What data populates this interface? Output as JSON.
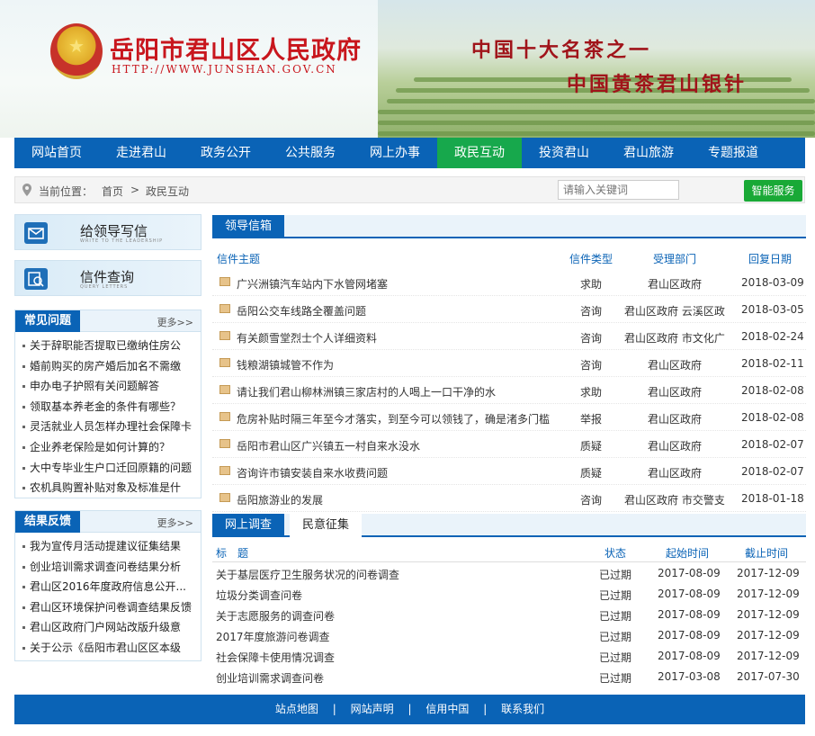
{
  "header": {
    "site_title": "岳阳市君山区人民政府",
    "site_url": "HTTP://WWW.JUNSHAN.GOV.CN",
    "slogan_line1": "中国十大名茶之一",
    "slogan_line2": "中国黄茶君山银针"
  },
  "nav": [
    "网站首页",
    "走进君山",
    "政务公开",
    "公共服务",
    "网上办事",
    "政民互动",
    "投资君山",
    "君山旅游",
    "专题报道"
  ],
  "nav_active_index": 5,
  "breadcrumb": {
    "label": "当前位置：",
    "home": "首页",
    "sep": ">",
    "current": "政民互动"
  },
  "search": {
    "placeholder": "请输入关键词",
    "button": "智能服务"
  },
  "side_buttons": [
    {
      "title": "给领导写信",
      "sub": "WRITE TO THE LEADERSHIP"
    },
    {
      "title": "信件查询",
      "sub": "QUERY LETTERS"
    }
  ],
  "faq": {
    "title": "常见问题",
    "more": "更多>>",
    "items": [
      "关于辞职能否提取已缴纳住房公",
      "婚前购买的房产婚后加名不需缴",
      "申办电子护照有关问题解答",
      "领取基本养老金的条件有哪些？",
      "灵活就业人员怎样办理社会保障卡",
      "企业养老保险是如何计算的？",
      "大中专毕业生户口迁回原籍的问题",
      "农机具购置补贴对象及标准是什"
    ]
  },
  "feedback": {
    "title": "结果反馈",
    "more": "更多>>",
    "items": [
      "我为宣传月活动提建议征集结果",
      "创业培训需求调查问卷结果分析",
      "君山区2016年度政府信息公开...",
      "君山区环境保护问卷调查结果反馈",
      "君山区政府门户网站改版升级意",
      "关于公示《岳阳市君山区区本级"
    ]
  },
  "mailbox": {
    "tab": "领导信箱",
    "columns": [
      "信件主题",
      "信件类型",
      "受理部门",
      "回复日期"
    ],
    "rows": [
      [
        "广兴洲镇汽车站内下水管网堵塞",
        "求助",
        "君山区政府",
        "2018-03-09"
      ],
      [
        "岳阳公交车线路全覆盖问题",
        "咨询",
        "君山区政府 云溪区政",
        "2018-03-05"
      ],
      [
        "有关颜雪堂烈士个人详细资料",
        "咨询",
        "君山区政府 市文化广",
        "2018-02-24"
      ],
      [
        "钱粮湖镇城管不作为",
        "咨询",
        "君山区政府",
        "2018-02-11"
      ],
      [
        "请让我们君山柳林洲镇三家店村的人喝上一口干净的水",
        "求助",
        "君山区政府",
        "2018-02-08"
      ],
      [
        "危房补贴时隔三年至今才落实，到至今可以领钱了，确是渚多门槛",
        "举报",
        "君山区政府",
        "2018-02-08"
      ],
      [
        "岳阳市君山区广兴镇五一村自来水没水",
        "质疑",
        "君山区政府",
        "2018-02-07"
      ],
      [
        "咨询许市镇安装自来水收费问题",
        "质疑",
        "君山区政府",
        "2018-02-07"
      ],
      [
        "岳阳旅游业的发展",
        "咨询",
        "君山区政府 市交警支",
        "2018-01-18"
      ]
    ]
  },
  "survey": {
    "tab_active": "网上调查",
    "tab_other": "民意征集",
    "columns": [
      "标　题",
      "状态",
      "起始时间",
      "截止时间"
    ],
    "rows": [
      [
        "关于基层医疗卫生服务状况的问卷调查",
        "已过期",
        "2017-08-09",
        "2017-12-09"
      ],
      [
        "垃圾分类调查问卷",
        "已过期",
        "2017-08-09",
        "2017-12-09"
      ],
      [
        "关于志愿服务的调查问卷",
        "已过期",
        "2017-08-09",
        "2017-12-09"
      ],
      [
        "2017年度旅游问卷调查",
        "已过期",
        "2017-08-09",
        "2017-12-09"
      ],
      [
        "社会保障卡使用情况调查",
        "已过期",
        "2017-08-09",
        "2017-12-09"
      ],
      [
        "创业培训需求调查问卷",
        "已过期",
        "2017-03-08",
        "2017-07-30"
      ]
    ]
  },
  "footer": [
    "站点地图",
    "网站声明",
    "信用中国",
    "联系我们"
  ],
  "footer_sep": "|",
  "colors": {
    "primary": "#0a63b6",
    "active_green": "#17a84c",
    "title_red": "#c8161d"
  }
}
